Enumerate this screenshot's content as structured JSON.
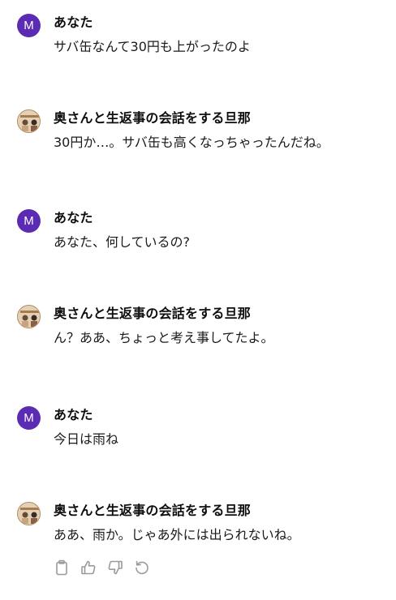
{
  "messages": [
    {
      "role": "user",
      "avatar_letter": "M",
      "name": "あなた",
      "text": "サバ缶なんて30円も上がったのよ"
    },
    {
      "role": "bot",
      "name": "奥さんと生返事の会話をする旦那",
      "text": "30円か…。サバ缶も高くなっちゃったんだね。"
    },
    {
      "role": "user",
      "avatar_letter": "M",
      "name": "あなた",
      "text": "あなた、何しているの?"
    },
    {
      "role": "bot",
      "name": "奥さんと生返事の会話をする旦那",
      "text": "ん？ああ、ちょっと考え事してたよ。"
    },
    {
      "role": "user",
      "avatar_letter": "M",
      "name": "あなた",
      "text": "今日は雨ね"
    },
    {
      "role": "bot",
      "name": "奥さんと生返事の会話をする旦那",
      "text": "ああ、雨か。じゃあ外には出られないね。"
    }
  ],
  "actions": [
    "copy-icon",
    "thumbs-up-icon",
    "thumbs-down-icon",
    "regenerate-icon"
  ],
  "colors": {
    "user_avatar": "#5b2bb3",
    "icon": "#9a9a9a"
  }
}
